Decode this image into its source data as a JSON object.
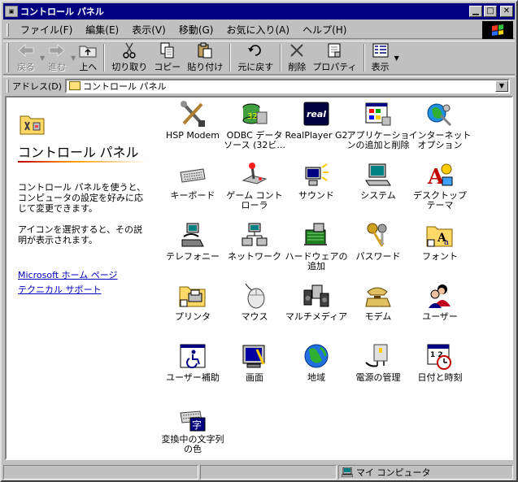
{
  "window": {
    "title": "コントロール パネル"
  },
  "menu": [
    "ファイル(F)",
    "編集(E)",
    "表示(V)",
    "移動(G)",
    "お気に入り(A)",
    "ヘルプ(H)"
  ],
  "toolbar": {
    "back": "戻る",
    "forward": "進む",
    "up": "上へ",
    "cut": "切り取り",
    "copy": "コピー",
    "paste": "貼り付け",
    "undo": "元に戻す",
    "delete": "削除",
    "properties": "プロパティ",
    "views": "表示"
  },
  "address": {
    "label": "アドレス(D)",
    "value": "コントロール パネル"
  },
  "left_pane": {
    "title": "コントロール パネル",
    "description": "コントロール パネルを使うと、コンピュータの設定を好みに応じて変更できます。",
    "hint": "アイコンを選択すると、その説明が表示されます。",
    "links": [
      "Microsoft ホーム ページ",
      "テクニカル サポート"
    ]
  },
  "items": [
    "HSP Modem",
    "ODBC データ ソース (32ビ...",
    "RealPlayer G2",
    "アプリケーションの追加と削除",
    "インターネット オプション",
    "キーボード",
    "ゲーム コントローラ",
    "サウンド",
    "システム",
    "デスクトップ テーマ",
    "テレフォニー",
    "ネットワーク",
    "ハードウェアの追加",
    "パスワード",
    "フォント",
    "プリンタ",
    "マウス",
    "マルチメディア",
    "モデム",
    "ユーザー",
    "ユーザー補助",
    "画面",
    "地域",
    "電源の管理",
    "日付と時刻",
    "変換中の文字列の色"
  ],
  "status": {
    "location": "マイ コンピュータ"
  },
  "colors": {
    "titlebar": "#000080",
    "window": "#c0c0c0",
    "link": "#0000c0"
  }
}
